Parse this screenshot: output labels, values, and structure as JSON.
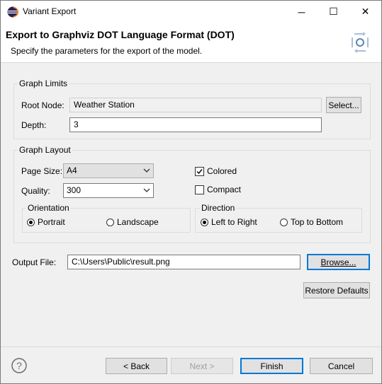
{
  "window": {
    "title": "Variant Export",
    "app_icon": "eclipse-icon",
    "controls": {
      "minimize": "─",
      "maximize": "☐",
      "close": "✕"
    }
  },
  "banner": {
    "title": "Export to Graphviz DOT Language Format (DOT)",
    "description": "Specify the parameters for the export of the model.",
    "icon": "export-wizard-icon"
  },
  "graph_limits": {
    "label": "Graph Limits",
    "root_node_label": "Root Node:",
    "root_node_value": "Weather Station",
    "select_button": "Select...",
    "depth_label": "Depth:",
    "depth_value": "3"
  },
  "graph_layout": {
    "label": "Graph Layout",
    "page_size_label": "Page Size:",
    "page_size_value": "A4",
    "quality_label": "Quality:",
    "quality_value": "300",
    "colored_label": "Colored",
    "colored_checked": true,
    "compact_label": "Compact",
    "compact_checked": false,
    "orientation": {
      "label": "Orientation",
      "options": [
        "Portrait",
        "Landscape"
      ],
      "selected": "Portrait"
    },
    "direction": {
      "label": "Direction",
      "options": [
        "Left to Right",
        "Top to Bottom"
      ],
      "selected": "Left to Right"
    }
  },
  "output": {
    "label": "Output File:",
    "value": "C:\\Users\\Public\\result.png",
    "browse_button": "Browse..."
  },
  "restore_defaults_button": "Restore Defaults",
  "footer": {
    "back": "< Back",
    "next": "Next >",
    "finish": "Finish",
    "cancel": "Cancel",
    "help_icon": "help-icon"
  },
  "colors": {
    "focus": "#0078d7",
    "dialog_bg": "#f0f0f0"
  }
}
